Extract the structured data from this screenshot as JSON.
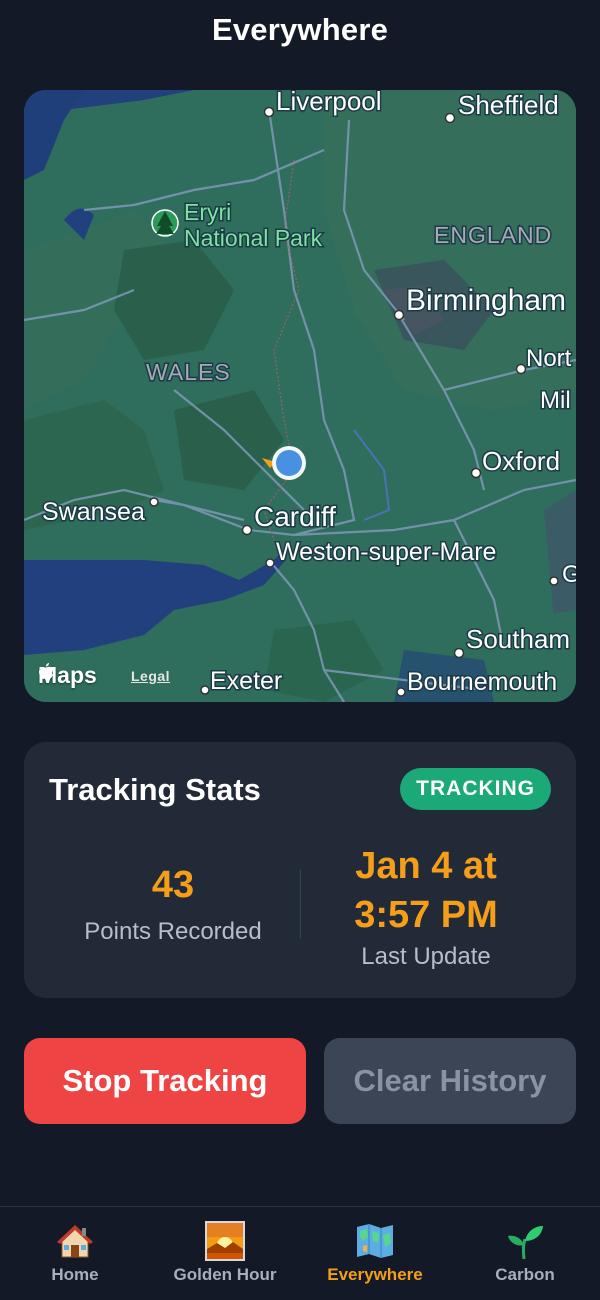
{
  "header": {
    "title": "Everywhere"
  },
  "map": {
    "places": {
      "liverpool": "Liverpool",
      "sheffield": "Sheffield",
      "eryri1": "Eryri",
      "eryri2": "National Park",
      "england": "ENGLAND",
      "birmingham": "Birmingham",
      "wales": "WALES",
      "north": "Nort",
      "milton": "Mil",
      "oxford": "Oxford",
      "swansea": "Swansea",
      "cardiff": "Cardiff",
      "weston": "Weston-super-Mare",
      "g": "G",
      "southampton": "Southam",
      "exeter": "Exeter",
      "bournemouth": "Bournemouth"
    },
    "brand": "Maps",
    "legal": "Legal"
  },
  "stats": {
    "title": "Tracking Stats",
    "status": "TRACKING",
    "points_value": "43",
    "points_label": "Points Recorded",
    "update_line1": "Jan 4 at",
    "update_line2": "3:57 PM",
    "update_label": "Last Update"
  },
  "actions": {
    "stop": "Stop Tracking",
    "clear": "Clear History"
  },
  "tabs": [
    {
      "label": "Home",
      "icon": "house-icon"
    },
    {
      "label": "Golden Hour",
      "icon": "sunrise-icon"
    },
    {
      "label": "Everywhere",
      "icon": "world-map-icon",
      "active": true
    },
    {
      "label": "Carbon",
      "icon": "seedling-icon"
    }
  ],
  "colors": {
    "accent": "#f59e1a",
    "tracking_badge": "#1aa977",
    "stop_button": "#ef4444",
    "clear_button": "#3b4555",
    "background": "#131927",
    "card": "#222a38"
  }
}
